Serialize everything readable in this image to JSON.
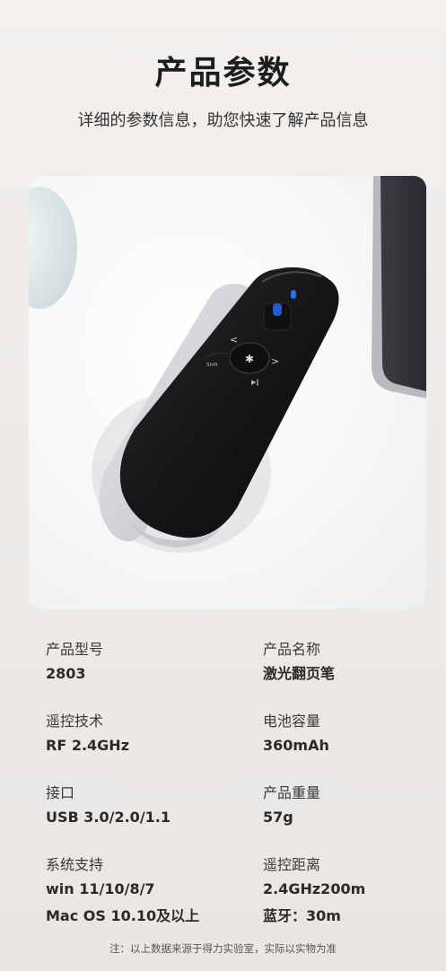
{
  "header": {
    "title": "产品参数",
    "subtitle": "详细的参数信息，助您快速了解产品信息"
  },
  "product_image": {
    "device_label": "Shift"
  },
  "specs": [
    {
      "label": "产品型号",
      "value": "2803"
    },
    {
      "label": "产品名称",
      "value": "激光翻页笔"
    },
    {
      "label": "遥控技术",
      "value": "RF 2.4GHz"
    },
    {
      "label": "电池容量",
      "value": "360mAh"
    },
    {
      "label": "接口",
      "value": "USB 3.0/2.0/1.1"
    },
    {
      "label": "产品重量",
      "value": "57g"
    },
    {
      "label": "系统支持",
      "value": "win 11/10/8/7",
      "value2": "Mac OS 10.10及以上"
    },
    {
      "label": "遥控距离",
      "value": "2.4GHz200m",
      "value2": "蓝牙：30m"
    }
  ],
  "footnote": "注：以上数据来源于得力实验室，实际以实物为准",
  "colors": {
    "background": "#efecea",
    "device": "#1a1a1c",
    "indicator": "#2f6bff"
  }
}
